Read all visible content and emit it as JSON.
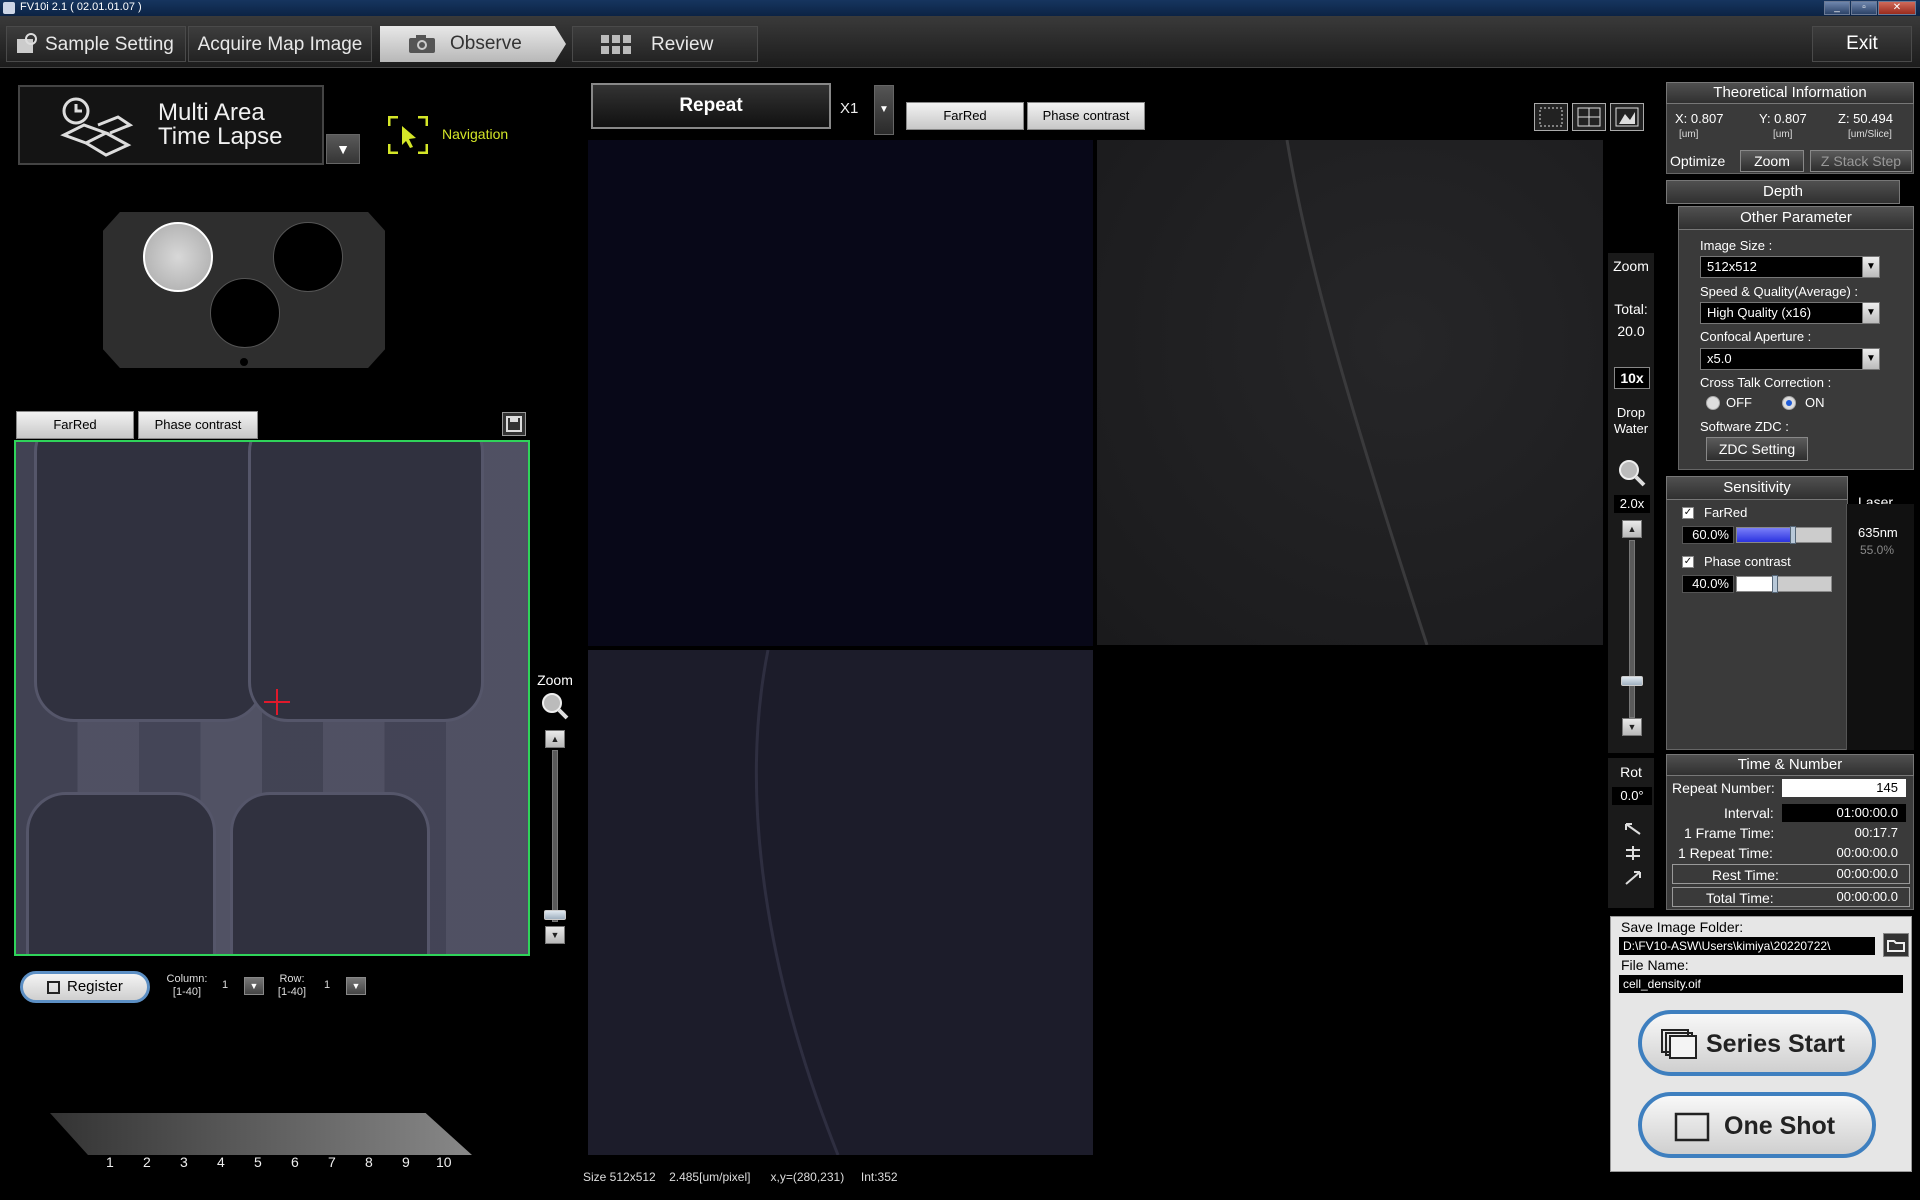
{
  "window": {
    "title": "FV10i 2.1 ( 02.01.01.07 )"
  },
  "menu": {
    "tabs": [
      {
        "label": "Sample Setting"
      },
      {
        "label": "Acquire Map Image"
      },
      {
        "label": "Observe"
      },
      {
        "label": "Review"
      }
    ],
    "exit_label": "Exit"
  },
  "mode": {
    "label": "Multi Area\nTime Lapse",
    "navigation_label": "Navigation"
  },
  "map": {
    "channels": [
      "FarRed",
      "Phase contrast"
    ],
    "zoom_label": "Zoom",
    "register_label": "Register",
    "column_label": "Column:",
    "column_range": "[1-40]",
    "column_value": "1",
    "row_label": "Row:",
    "row_range": "[1-40]",
    "row_value": "1",
    "scale_numbers": [
      "1",
      "2",
      "3",
      "4",
      "5",
      "6",
      "7",
      "8",
      "9",
      "10"
    ]
  },
  "observe": {
    "repeat_label": "Repeat",
    "multiplier": "X1",
    "channels": [
      "FarRed",
      "Phase contrast"
    ],
    "status": {
      "size": "Size 512x512",
      "pixel": "2.485[um/pixel]",
      "xy": "x,y=(280,231)",
      "intensity": "Int:352"
    }
  },
  "zoom_column": {
    "zoom_label": "Zoom",
    "total_label": "Total:",
    "total_value": "20.0",
    "objective": "10x",
    "drop_label": "Drop\nWater",
    "zoom_value": "2.0x",
    "zoom_level": 0.2,
    "rot_label": "Rot",
    "rot_value": "0.0°"
  },
  "theoretical": {
    "header": "Theoretical Information",
    "x_label": "X: 0.807",
    "x_unit": "[um]",
    "y_label": "Y: 0.807",
    "y_unit": "[um]",
    "z_label": "Z: 50.494",
    "z_unit": "[um/Slice]",
    "optimize_label": "Optimize",
    "zoom_btn": "Zoom",
    "zstack_btn": "Z Stack Step"
  },
  "depth": {
    "label": "Depth"
  },
  "other_parameter": {
    "header": "Other Parameter",
    "image_size_label": "Image Size :",
    "image_size_value": "512x512",
    "speed_label": "Speed & Quality(Average) :",
    "speed_value": "High Quality (x16)",
    "aperture_label": "Confocal Aperture :",
    "aperture_value": "x5.0",
    "crosstalk_label": "Cross Talk Correction :",
    "crosstalk_off": "OFF",
    "crosstalk_on": "ON",
    "crosstalk_selected": "ON",
    "zdc_label": "Software ZDC :",
    "zdc_button": "ZDC Setting"
  },
  "sensitivity": {
    "header": "Sensitivity",
    "laser_header": "Laser",
    "channels": [
      {
        "name": "FarRed",
        "checked": true,
        "value": "60.0%",
        "level": 0.6,
        "laser": "635nm",
        "laser_power": "55.0%",
        "color": "#2b33e0"
      },
      {
        "name": "Phase contrast",
        "checked": true,
        "value": "40.0%",
        "level": 0.4,
        "color": "#ffffff"
      }
    ]
  },
  "time_number": {
    "header": "Time & Number",
    "repeat_number_label": "Repeat Number:",
    "repeat_number_value": "145",
    "interval_label": "Interval:",
    "interval_value": "01:00:00.0",
    "frame_time_label": "1 Frame Time:",
    "frame_time_value": "00:17.7",
    "repeat_time_label": "1 Repeat Time:",
    "repeat_time_value": "00:00:00.0",
    "rest_time_label": "Rest Time:",
    "rest_time_value": "00:00:00.0",
    "total_time_label": "Total Time:",
    "total_time_value": "00:00:00.0"
  },
  "save": {
    "folder_label": "Save Image Folder:",
    "folder_value": "D:\\FV10-ASW\\Users\\kimiya\\20220722\\",
    "file_label": "File Name:",
    "file_value": "cell_density.oif",
    "series_start": "Series Start",
    "one_shot": "One Shot"
  },
  "colors": {
    "map_border": "#2fd35a",
    "navigation": "#d4e628",
    "button_ring": "#3e7fbf",
    "crosshair": "#e0192b"
  },
  "icons": [
    "sample-setting-icon",
    "camera-icon",
    "grid-icon",
    "multi-area-icon",
    "navigation-icon",
    "save-icon",
    "zoom-icon",
    "folder-icon",
    "series-icon",
    "one-shot-icon",
    "view-layout-icons",
    "rotate-icons"
  ]
}
